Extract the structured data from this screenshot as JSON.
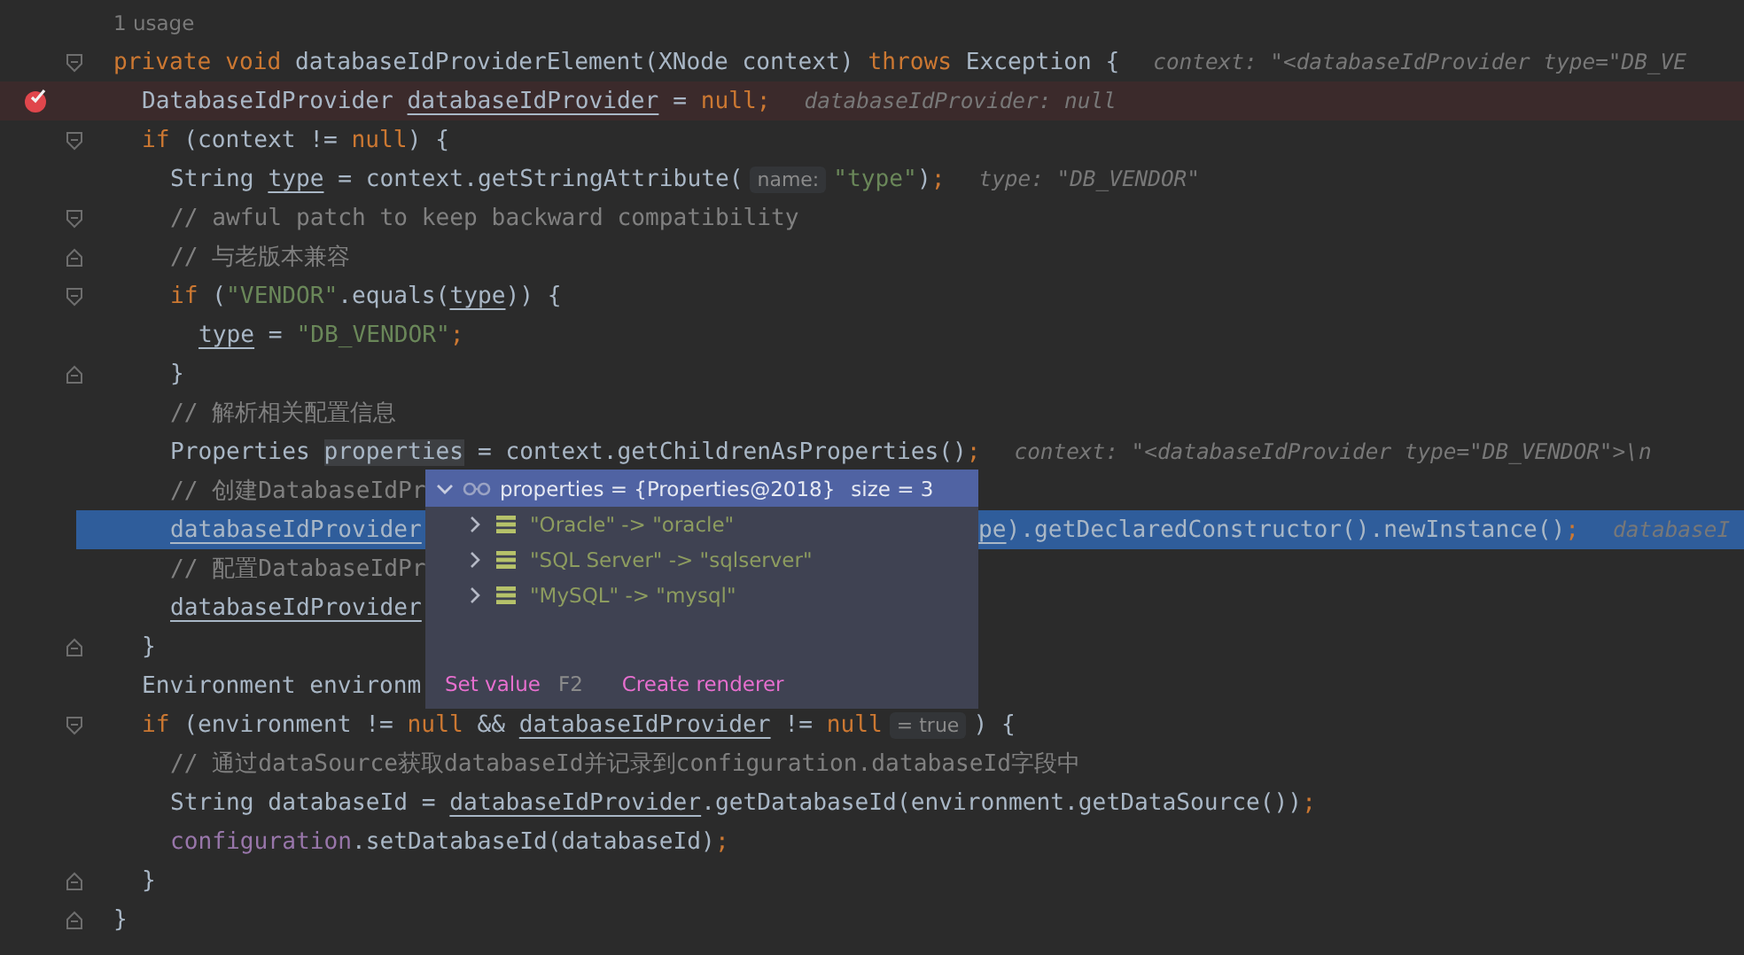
{
  "usage_hint": "1 usage",
  "lines": [
    {
      "fold_start": true,
      "fold_end": false,
      "breakpoint": false,
      "current": false,
      "tokens": [
        {
          "kind": "kw",
          "text": "private void "
        },
        {
          "kind": "text",
          "text": "databaseIdProviderElement(XNode context) "
        },
        {
          "kind": "kw",
          "text": "throws "
        },
        {
          "kind": "text",
          "text": "Exception {"
        },
        {
          "kind": "hint",
          "text": "context: \"<databaseIdProvider type=\"DB_VE"
        }
      ],
      "children": [
        {
          "fold_start": false,
          "fold_end": false,
          "breakpoint": true,
          "current": false,
          "tokens": [
            {
              "kind": "text",
              "text": "DatabaseIdProvider "
            },
            {
              "kind": "var",
              "text": "databaseIdProvider"
            },
            {
              "kind": "text",
              "text": " = "
            },
            {
              "kind": "kw",
              "text": "null"
            },
            {
              "kind": "kw",
              "text": ";"
            },
            {
              "kind": "hint",
              "text": "databaseIdProvider: null"
            }
          ]
        },
        {
          "fold_start": true,
          "fold_end": false,
          "breakpoint": false,
          "current": false,
          "tokens": [
            {
              "kind": "kw",
              "text": "if "
            },
            {
              "kind": "text",
              "text": "(context != "
            },
            {
              "kind": "kw",
              "text": "null"
            },
            {
              "kind": "text",
              "text": ") {"
            }
          ],
          "children": [
            {
              "fold_start": false,
              "fold_end": false,
              "breakpoint": false,
              "current": false,
              "tokens": [
                {
                  "kind": "text",
                  "text": "String "
                },
                {
                  "kind": "var",
                  "text": "type"
                },
                {
                  "kind": "text",
                  "text": " = context.getStringAttribute("
                },
                {
                  "kind": "inlay",
                  "text": "name:"
                },
                {
                  "kind": "str",
                  "text": "\"type\""
                },
                {
                  "kind": "text",
                  "text": ")"
                },
                {
                  "kind": "kw",
                  "text": ";"
                },
                {
                  "kind": "hint",
                  "text": "type: \"DB_VENDOR\""
                }
              ]
            },
            {
              "fold_start": true,
              "fold_end": false,
              "breakpoint": false,
              "current": false,
              "tokens": [
                {
                  "kind": "comment",
                  "text": "// awful patch to keep backward compatibility"
                }
              ]
            },
            {
              "fold_start": false,
              "fold_end": true,
              "breakpoint": false,
              "current": false,
              "tokens": [
                {
                  "kind": "comment",
                  "text": "// 与老版本兼容"
                }
              ]
            },
            {
              "fold_start": true,
              "fold_end": false,
              "breakpoint": false,
              "current": false,
              "tokens": [
                {
                  "kind": "kw",
                  "text": "if "
                },
                {
                  "kind": "text",
                  "text": "("
                },
                {
                  "kind": "str",
                  "text": "\"VENDOR\""
                },
                {
                  "kind": "text",
                  "text": ".equals("
                },
                {
                  "kind": "var",
                  "text": "type"
                },
                {
                  "kind": "text",
                  "text": ")) {"
                }
              ],
              "children": [
                {
                  "fold_start": false,
                  "fold_end": false,
                  "breakpoint": false,
                  "current": false,
                  "tokens": [
                    {
                      "kind": "var",
                      "text": "type"
                    },
                    {
                      "kind": "text",
                      "text": " = "
                    },
                    {
                      "kind": "str",
                      "text": "\"DB_VENDOR\""
                    },
                    {
                      "kind": "kw",
                      "text": ";"
                    }
                  ]
                }
              ]
            },
            {
              "fold_start": false,
              "fold_end": true,
              "breakpoint": false,
              "current": false,
              "tokens": [
                {
                  "kind": "text",
                  "text": "}"
                }
              ]
            },
            {
              "fold_start": false,
              "fold_end": false,
              "breakpoint": false,
              "current": false,
              "tokens": [
                {
                  "kind": "comment",
                  "text": "// 解析相关配置信息"
                }
              ]
            },
            {
              "fold_start": false,
              "fold_end": false,
              "breakpoint": false,
              "current": false,
              "tokens": [
                {
                  "kind": "text",
                  "text": "Properties "
                },
                {
                  "kind": "usage",
                  "text": "properties"
                },
                {
                  "kind": "text",
                  "text": " = context.getChildrenAsProperties()"
                },
                {
                  "kind": "kw",
                  "text": ";"
                },
                {
                  "kind": "hint",
                  "text": "context: \"<databaseIdProvider type=\"DB_VENDOR\">\\n"
                }
              ]
            },
            {
              "fold_start": false,
              "fold_end": false,
              "breakpoint": false,
              "current": false,
              "tokens": [
                {
                  "kind": "comment",
                  "text": "// 创建DatabaseIdPr"
                }
              ]
            },
            {
              "fold_start": false,
              "fold_end": false,
              "breakpoint": false,
              "current": true,
              "tokens": [
                {
                  "kind": "var",
                  "text": "databaseIdProvider"
                }
              ],
              "tail": [
                {
                  "kind": "var",
                  "text": "pe"
                },
                {
                  "kind": "text",
                  "text": ").getDeclaredConstructor().newInstance()"
                },
                {
                  "kind": "kw",
                  "text": ";"
                },
                {
                  "kind": "hint",
                  "text": "databaseI"
                }
              ]
            },
            {
              "fold_start": false,
              "fold_end": false,
              "breakpoint": false,
              "current": false,
              "tokens": [
                {
                  "kind": "comment",
                  "text": "// 配置DatabaseIdPr"
                }
              ]
            },
            {
              "fold_start": false,
              "fold_end": false,
              "breakpoint": false,
              "current": false,
              "tokens": [
                {
                  "kind": "var",
                  "text": "databaseIdProvider"
                }
              ]
            }
          ]
        },
        {
          "fold_start": false,
          "fold_end": true,
          "breakpoint": false,
          "current": false,
          "tokens": [
            {
              "kind": "text",
              "text": "}"
            }
          ]
        },
        {
          "fold_start": false,
          "fold_end": false,
          "breakpoint": false,
          "current": false,
          "tokens": [
            {
              "kind": "text",
              "text": "Environment environm"
            }
          ]
        },
        {
          "fold_start": true,
          "fold_end": false,
          "breakpoint": false,
          "current": false,
          "tokens": [
            {
              "kind": "kw",
              "text": "if "
            },
            {
              "kind": "text",
              "text": "(environment != "
            },
            {
              "kind": "kw",
              "text": "null"
            },
            {
              "kind": "text",
              "text": " && "
            },
            {
              "kind": "var",
              "text": "databaseIdProvider"
            },
            {
              "kind": "text",
              "text": " != "
            },
            {
              "kind": "kw",
              "text": "null"
            },
            {
              "kind": "inlay",
              "text": "= true"
            },
            {
              "kind": "text",
              "text": " ) {"
            }
          ],
          "children": [
            {
              "fold_start": false,
              "fold_end": false,
              "breakpoint": false,
              "current": false,
              "tokens": [
                {
                  "kind": "comment",
                  "text": "// 通过dataSource获取databaseId并记录到configuration.databaseId字段中"
                }
              ]
            },
            {
              "fold_start": false,
              "fold_end": false,
              "breakpoint": false,
              "current": false,
              "tokens": [
                {
                  "kind": "text",
                  "text": "String databaseId = "
                },
                {
                  "kind": "var",
                  "text": "databaseIdProvider"
                },
                {
                  "kind": "text",
                  "text": ".getDatabaseId(environment.getDataSource())"
                },
                {
                  "kind": "kw",
                  "text": ";"
                }
              ]
            },
            {
              "fold_start": false,
              "fold_end": false,
              "breakpoint": false,
              "current": false,
              "tokens": [
                {
                  "kind": "field",
                  "text": "configuration"
                },
                {
                  "kind": "text",
                  "text": ".setDatabaseId(databaseId)"
                },
                {
                  "kind": "kw",
                  "text": ";"
                }
              ]
            }
          ]
        },
        {
          "fold_start": false,
          "fold_end": true,
          "breakpoint": false,
          "current": false,
          "tokens": [
            {
              "kind": "text",
              "text": "}"
            }
          ]
        }
      ]
    },
    {
      "fold_start": false,
      "fold_end": true,
      "breakpoint": false,
      "current": false,
      "tokens": [
        {
          "kind": "text",
          "text": "}"
        }
      ]
    }
  ],
  "popup": {
    "expanded": true,
    "title": "properties = {Properties@2018}",
    "size": "size = 3",
    "items": [
      {
        "expanded": false,
        "text": "\"Oracle\" -> \"oracle\""
      },
      {
        "expanded": false,
        "text": "\"SQL Server\" -> \"sqlserver\""
      },
      {
        "expanded": false,
        "text": "\"MySQL\" -> \"mysql\""
      }
    ],
    "actions": [
      {
        "label": "Set value",
        "shortcut": "F2"
      },
      {
        "label": "Create renderer"
      }
    ]
  }
}
